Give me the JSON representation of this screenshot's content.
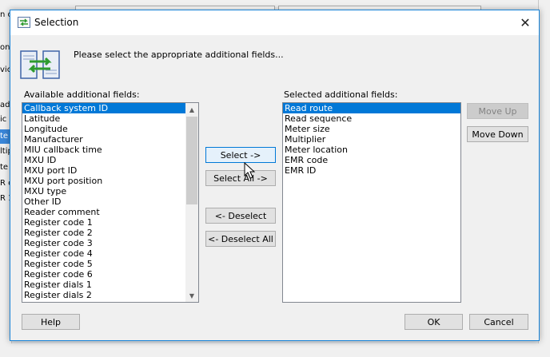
{
  "background": {
    "left_fragments": [
      "n o",
      "on",
      "vic",
      "ad",
      "ic",
      "te",
      "ltip",
      "te",
      "R c",
      "R 1"
    ],
    "selected_fragment_index": 5
  },
  "dialog": {
    "title": "Selection",
    "close_glyph": "✕",
    "instruction": "Please select the appropriate additional fields...",
    "available": {
      "label": "Available additional fields:",
      "items": [
        "Callback system ID",
        "Latitude",
        "Longitude",
        "Manufacturer",
        "MIU callback time",
        "MXU ID",
        "MXU port ID",
        "MXU port position",
        "MXU type",
        "Other ID",
        "Reader comment",
        "Register code 1",
        "Register code 2",
        "Register code 3",
        "Register code 4",
        "Register code 5",
        "Register code 6",
        "Register dials 1",
        "Register dials 2"
      ],
      "selected_index": 0,
      "scroll_up": "▲",
      "scroll_down": "▼"
    },
    "selected": {
      "label": "Selected additional fields:",
      "items": [
        "Read route",
        "Read sequence",
        "Meter size",
        "Multiplier",
        "Meter location",
        "EMR code",
        "EMR ID"
      ],
      "selected_index": 0
    },
    "buttons": {
      "select": "Select ->",
      "select_all": "Select All ->",
      "deselect": "<- Deselect",
      "deselect_all": "<- Deselect All",
      "move_up": "Move Up",
      "move_down": "Move Down",
      "help": "Help",
      "ok": "OK",
      "cancel": "Cancel"
    },
    "colors": {
      "accent": "#0078d7",
      "border": "#1883d7"
    }
  }
}
